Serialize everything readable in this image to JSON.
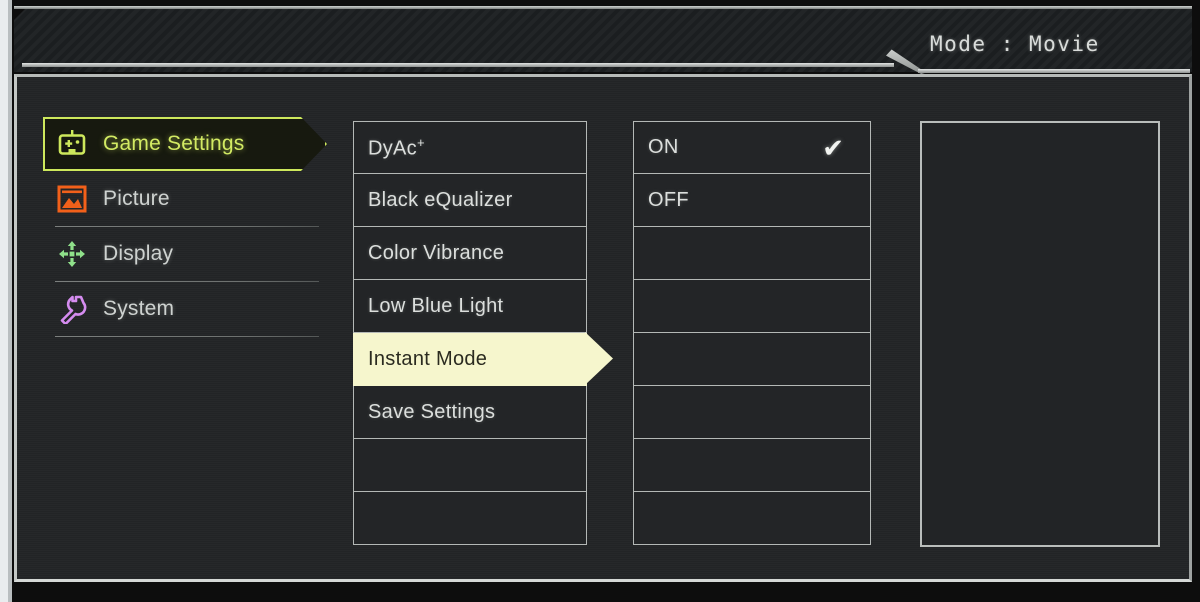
{
  "header": {
    "mode_text": "Mode : Movie"
  },
  "sidebar": {
    "items": [
      {
        "label": "Game Settings",
        "icon": "gamepad-icon",
        "color": "#cde85c",
        "selected": true
      },
      {
        "label": "Picture",
        "icon": "picture-icon",
        "color": "#f2601a",
        "selected": false
      },
      {
        "label": "Display",
        "icon": "resize-arrows-icon",
        "color": "#8fe08a",
        "selected": false
      },
      {
        "label": "System",
        "icon": "wrench-icon",
        "color": "#d58cf0",
        "selected": false
      }
    ]
  },
  "menu": {
    "items": [
      {
        "label": "DyAc",
        "superscript": "+",
        "selected": false
      },
      {
        "label": "Black eQualizer",
        "superscript": "",
        "selected": false
      },
      {
        "label": "Color Vibrance",
        "superscript": "",
        "selected": false
      },
      {
        "label": "Low Blue Light",
        "superscript": "",
        "selected": false
      },
      {
        "label": "Instant Mode",
        "superscript": "",
        "selected": true
      },
      {
        "label": "Save Settings",
        "superscript": "",
        "selected": false
      },
      {
        "label": "",
        "superscript": "",
        "selected": false
      },
      {
        "label": "",
        "superscript": "",
        "selected": false
      }
    ]
  },
  "options": {
    "items": [
      {
        "label": "ON",
        "checked": true
      },
      {
        "label": "OFF",
        "checked": false
      },
      {
        "label": "",
        "checked": false
      },
      {
        "label": "",
        "checked": false
      },
      {
        "label": "",
        "checked": false
      },
      {
        "label": "",
        "checked": false
      },
      {
        "label": "",
        "checked": false
      },
      {
        "label": "",
        "checked": false
      }
    ],
    "check_glyph": "✔"
  },
  "preview_panel": {
    "content": ""
  },
  "colors": {
    "accent_green": "#cde85c",
    "highlight_fill": "#f6f6cd",
    "panel_bg": "#232527",
    "border": "#b4b8b6"
  }
}
